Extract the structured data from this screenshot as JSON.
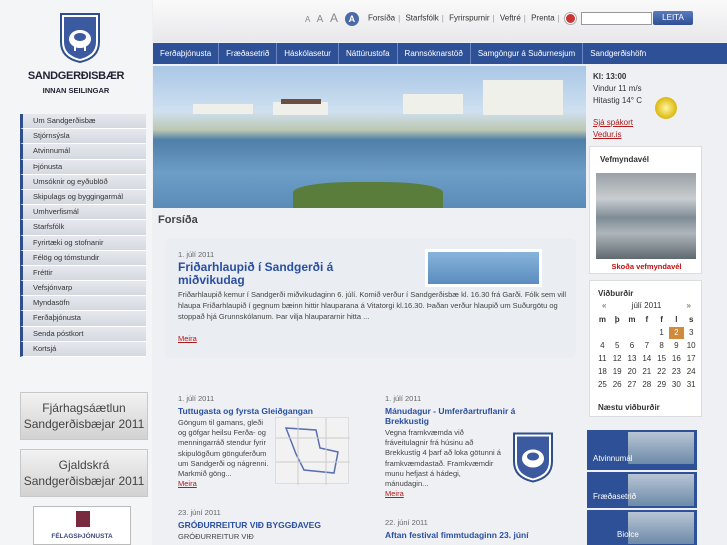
{
  "logo": {
    "line1": "SANDGERÐISBÆR",
    "line2": "INNAN SEILINGAR"
  },
  "left_nav": [
    "Um Sandgerðisbæ",
    "Stjórnsýsla",
    "Atvinnumál",
    "Þjónusta",
    "Umsóknir og eyðublöð",
    "Skipulags og byggingarmál",
    "Umhverfismál",
    "Starfsfólk",
    "Fyrirtæki og stofnanir",
    "Félög og tómstundir",
    "Fréttir",
    "Vefsjónvarp",
    "Myndasöfn",
    "Ferðaþjónusta",
    "Senda póstkort",
    "Kortsjá"
  ],
  "promos": [
    {
      "l1": "Fjárhagsáætlun",
      "l2": "Sandgerðisbæjar 2011"
    },
    {
      "l1": "Gjaldskrá",
      "l2": "Sandgerðisbæjar 2011"
    }
  ],
  "felag": "FÉLAGSÞJÓNUSTA",
  "font_sizes": [
    "A",
    "A",
    "A",
    "A"
  ],
  "utility": [
    "Forsíða",
    "Starfsfólk",
    "Fyrirspurnir",
    "Veftré",
    "Prenta"
  ],
  "search": {
    "placeholder": "",
    "button": "LEITA"
  },
  "top_nav": [
    "Ferðaþjónusta",
    "Fræðasetrið",
    "Háskólasetur",
    "Náttúrustofa",
    "Rannsóknarstöð",
    "Samgöngur á Suðurnesjum",
    "Sandgerðishöfn"
  ],
  "weather": {
    "time": "Kl: 13:00",
    "wind": "Vindur 11 m/s",
    "temp": "Hitastig 14° C",
    "link1": "Sjá spákort",
    "link2": "Vedur.is"
  },
  "webcam": {
    "title": "Vefmyndavél",
    "link": "Skoða vefmyndavél"
  },
  "calendar": {
    "title": "Viðburðir",
    "month": "júlí 2011",
    "prev": "«",
    "next_arrow": "»",
    "days": [
      "m",
      "þ",
      "m",
      "f",
      "f",
      "l",
      "s"
    ],
    "cells": [
      "",
      "",
      "",
      "",
      "1",
      "2",
      "3",
      "4",
      "5",
      "6",
      "7",
      "8",
      "9",
      "10",
      "11",
      "12",
      "13",
      "14",
      "15",
      "16",
      "17",
      "18",
      "19",
      "20",
      "21",
      "22",
      "23",
      "24",
      "25",
      "26",
      "27",
      "28",
      "29",
      "30",
      "31"
    ],
    "today": "2",
    "upcoming": "Næstu viðburðir"
  },
  "thumbs": [
    "Atvinnumál",
    "Fræðasetrið",
    "Biolce"
  ],
  "page_title": "Forsíða",
  "feature": {
    "date": "1. júlí 2011",
    "headline": "Friðarhlaupið í Sandgerði á miðvikudag",
    "body": "Friðarhlaupið kemur í Sandgerði miðvikudaginn 6. júlí. Komið verður í Sandgerðisbæ kl. 16.30 frá Garði. Fólk sem vill hlaupa Friðarhlaupið í gegnum bæinn hittir hlauparana á Vitatorgi kl.16.30. Þaðan verður hlaupið um Suðurgötu og stoppað hjá Grunnskólanum. Þar vilja hlaupararnir hitta ...",
    "more": "Meira"
  },
  "news": [
    {
      "date": "1. júlí 2011",
      "headline": "Tuttugasta og fyrsta Gleiðgangan",
      "body": "Göngum til gamans, gleði og göfgar heilsu Ferða- og menningarráð stendur fyrir skipulögðum gönguferðum um Sandgerði og nágrenni. Markmið göng...",
      "more": "Meira"
    },
    {
      "date": "1. júlí 2011",
      "headline": "Mánudagur - Umferðartruflanir á Brekkustig",
      "body": "Vegna framkvæmda við fráveitulagnir frá húsinu að Brekkustíg 4 þarf að loka götunni á framkvæmdastað. Framkvæmdir munu hefjast á hádegi, mánudagin...",
      "more": "Meira"
    },
    {
      "date": "23. júní 2011",
      "headline": "GRÓÐURREITUR VIÐ BYGGÐAVEG",
      "body": "GRÓÐURREITUR VIÐ",
      "more": ""
    },
    {
      "date": "22. júní 2011",
      "headline": "Aftan festival fimmtudaginn 23. júní",
      "body": "",
      "more": ""
    }
  ]
}
